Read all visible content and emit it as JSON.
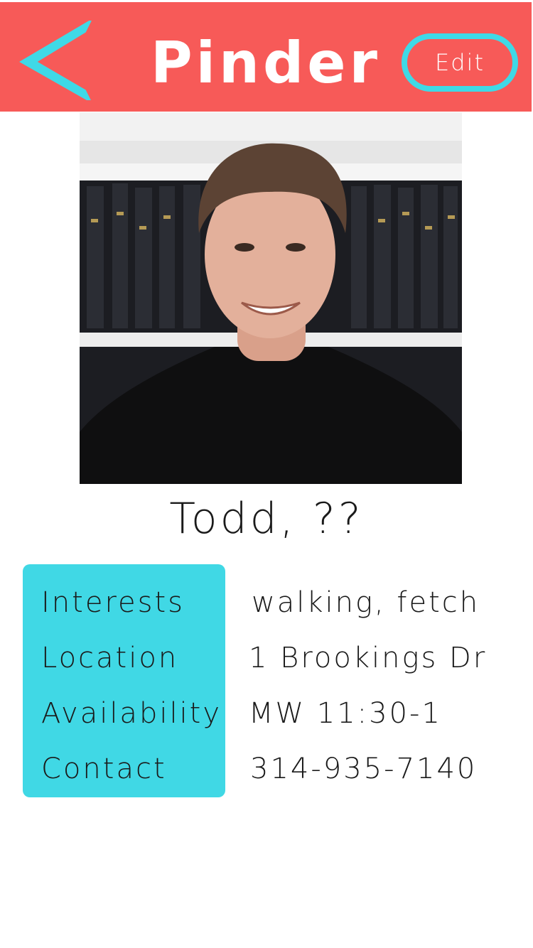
{
  "header": {
    "title": "Pinder",
    "back_icon": "chevron-left-icon",
    "edit_label": "Edit"
  },
  "colors": {
    "header_bg": "#f75a58",
    "accent": "#40d8e5",
    "text": "#1a1a1a"
  },
  "profile": {
    "name_age": "Todd, ??",
    "photo": "profile-photo"
  },
  "details": [
    {
      "label": "Interests",
      "value": "walking, fetch"
    },
    {
      "label": "Location",
      "value": "1 Brookings Dr"
    },
    {
      "label": "Availability",
      "value": "MW 11:30-1"
    },
    {
      "label": "Contact",
      "value": "314-935-7140"
    }
  ]
}
